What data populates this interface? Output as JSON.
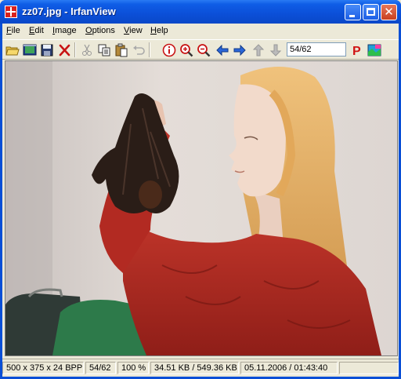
{
  "window": {
    "title": "zz07.jpg - IrfanView"
  },
  "menu": [
    {
      "label": "File",
      "key": "F",
      "rest": "ile"
    },
    {
      "label": "Edit",
      "key": "E",
      "rest": "dit"
    },
    {
      "label": "Image",
      "key": "I",
      "rest": "mage"
    },
    {
      "label": "Options",
      "key": "O",
      "rest": "ptions"
    },
    {
      "label": "View",
      "key": "V",
      "rest": "iew"
    },
    {
      "label": "Help",
      "key": "H",
      "rest": "elp"
    }
  ],
  "toolbar": {
    "icons": [
      "open-folder-icon",
      "slideshow-icon",
      "save-icon",
      "delete-icon",
      "cut-icon",
      "copy-icon",
      "paste-icon",
      "undo-icon",
      "info-icon",
      "zoom-in-icon",
      "zoom-out-icon",
      "previous-icon",
      "next-icon",
      "first-file-icon",
      "last-file-icon",
      "print-icon",
      "effects-icon"
    ],
    "page_value": "54/62"
  },
  "image": {
    "file": "zz07.jpg"
  },
  "status": {
    "dimensions": "500 x 375 x 24 BPP",
    "index": "54/62",
    "zoom": "100 %",
    "size": "34.51 KB / 549.36 KB",
    "datetime": "05.11.2006 / 01:43:40"
  },
  "colors": {
    "titlebar": "#0b4fd8",
    "chrome": "#ece9d8",
    "sweater": "#b52a22",
    "hair": "#e8b56a"
  }
}
